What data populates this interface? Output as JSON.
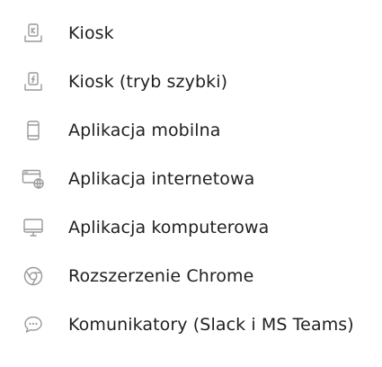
{
  "options": {
    "items": [
      {
        "icon": "kiosk-icon",
        "label": "Kiosk"
      },
      {
        "icon": "kiosk-fast-mode-icon",
        "label": "Kiosk (tryb szybki)"
      },
      {
        "icon": "mobile-phone-icon",
        "label": "Aplikacja mobilna"
      },
      {
        "icon": "web-app-globe-icon",
        "label": "Aplikacja internetowa"
      },
      {
        "icon": "desktop-monitor-icon",
        "label": "Aplikacja komputerowa"
      },
      {
        "icon": "chrome-icon",
        "label": "Rozszerzenie Chrome"
      },
      {
        "icon": "chat-bubble-icon",
        "label": "Komunikatory (Slack i MS Teams)"
      }
    ],
    "icon_color": "#9a9a9a",
    "text_color": "#1f1f1f"
  }
}
